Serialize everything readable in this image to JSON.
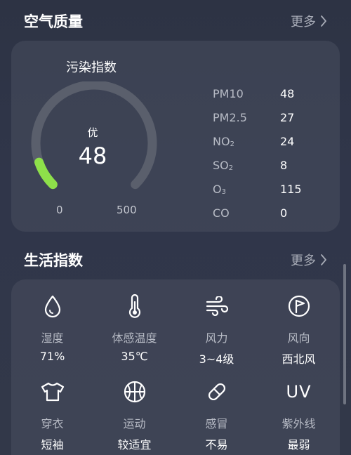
{
  "air_quality": {
    "title": "空气质量",
    "more_label": "更多",
    "gauge": {
      "title": "污染指数",
      "level": "优",
      "value": "48",
      "min_label": "0",
      "max_label": "500",
      "fraction": 0.096,
      "accent_color": "#8ee04a"
    },
    "pollutants": [
      {
        "name": "PM10",
        "sub": "",
        "value": "48"
      },
      {
        "name": "PM2.5",
        "sub": "",
        "value": "27"
      },
      {
        "name": "NO",
        "sub": "2",
        "value": "24"
      },
      {
        "name": "SO",
        "sub": "2",
        "value": "8"
      },
      {
        "name": "O",
        "sub": "3",
        "value": "115"
      },
      {
        "name": "CO",
        "sub": "",
        "value": "0"
      }
    ]
  },
  "life_index": {
    "title": "生活指数",
    "more_label": "更多",
    "items": [
      {
        "icon": "droplet-icon",
        "label": "湿度",
        "value": "71%"
      },
      {
        "icon": "thermometer-icon",
        "label": "体感温度",
        "value": "35℃"
      },
      {
        "icon": "wind-icon",
        "label": "风力",
        "value": "3~4级"
      },
      {
        "icon": "wind-direction-icon",
        "label": "风向",
        "value": "西北风"
      },
      {
        "icon": "tshirt-icon",
        "label": "穿衣",
        "value": "短袖"
      },
      {
        "icon": "basketball-icon",
        "label": "运动",
        "value": "较适宜"
      },
      {
        "icon": "pill-icon",
        "label": "感冒",
        "value": "不易"
      },
      {
        "icon": "uv-icon",
        "icon_text": "UV",
        "label": "紫外线",
        "value": "最弱"
      }
    ]
  }
}
